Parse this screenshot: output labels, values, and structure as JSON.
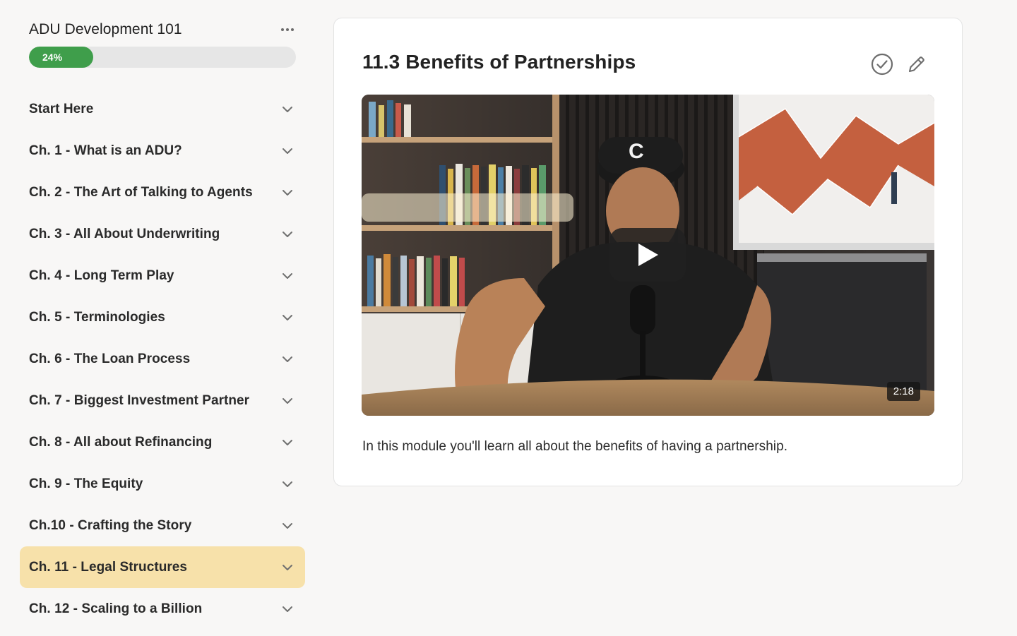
{
  "course": {
    "title": "ADU Development 101",
    "progress_percent": 24,
    "progress_label": "24%"
  },
  "chapters": [
    {
      "label": "Start Here",
      "active": false
    },
    {
      "label": "Ch. 1 - What is an ADU?",
      "active": false
    },
    {
      "label": "Ch. 2 - The Art of Talking to Agents",
      "active": false
    },
    {
      "label": "Ch. 3 - All About Underwriting",
      "active": false
    },
    {
      "label": "Ch. 4 - Long Term Play",
      "active": false
    },
    {
      "label": "Ch. 5 - Terminologies",
      "active": false
    },
    {
      "label": "Ch. 6 - The Loan Process",
      "active": false
    },
    {
      "label": "Ch. 7 - Biggest Investment Partner",
      "active": false
    },
    {
      "label": "Ch. 8 - All about Refinancing",
      "active": false
    },
    {
      "label": "Ch. 9 - The Equity",
      "active": false
    },
    {
      "label": "Ch.10 - Crafting the Story",
      "active": false
    },
    {
      "label": "Ch. 11 - Legal Structures",
      "active": true
    },
    {
      "label": "Ch. 12 - Scaling to a Billion",
      "active": false
    }
  ],
  "lesson": {
    "title": "11.3 Benefits of Partnerships",
    "video_duration": "2:18",
    "description": "In this module you'll learn all about the benefits of having a partnership."
  },
  "icons": {
    "more": "more-horizontal-icon",
    "chevron": "chevron-down-icon",
    "complete": "check-circle-icon",
    "edit": "pencil-icon",
    "play": "play-icon"
  },
  "colors": {
    "progress_fill": "#3f9e4b",
    "active_chapter_bg": "#f7e1aa",
    "page_bg": "#f8f7f6"
  }
}
